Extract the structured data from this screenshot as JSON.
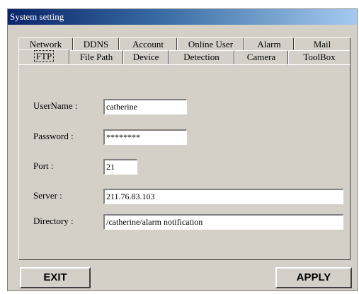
{
  "window": {
    "title": "System setting"
  },
  "tabs_row1": [
    {
      "label": "Network"
    },
    {
      "label": "DDNS"
    },
    {
      "label": "Account"
    },
    {
      "label": "Online User"
    },
    {
      "label": "Alarm"
    },
    {
      "label": "Mail"
    }
  ],
  "tabs_row2": [
    {
      "label": "FTP",
      "active": true
    },
    {
      "label": "File Path"
    },
    {
      "label": "Device"
    },
    {
      "label": "Detection"
    },
    {
      "label": "Camera"
    },
    {
      "label": "ToolBox"
    }
  ],
  "form": {
    "username": {
      "label": "UserName :",
      "value": "catherine"
    },
    "password": {
      "label": "Password :",
      "value": "********"
    },
    "port": {
      "label": "Port :",
      "value": "21"
    },
    "server": {
      "label": "Server :",
      "value": "211.76.83.103"
    },
    "directory": {
      "label": "Directory :",
      "value": "/catherine/alarm notification"
    }
  },
  "buttons": {
    "exit": "EXIT",
    "apply": "APPLY"
  }
}
